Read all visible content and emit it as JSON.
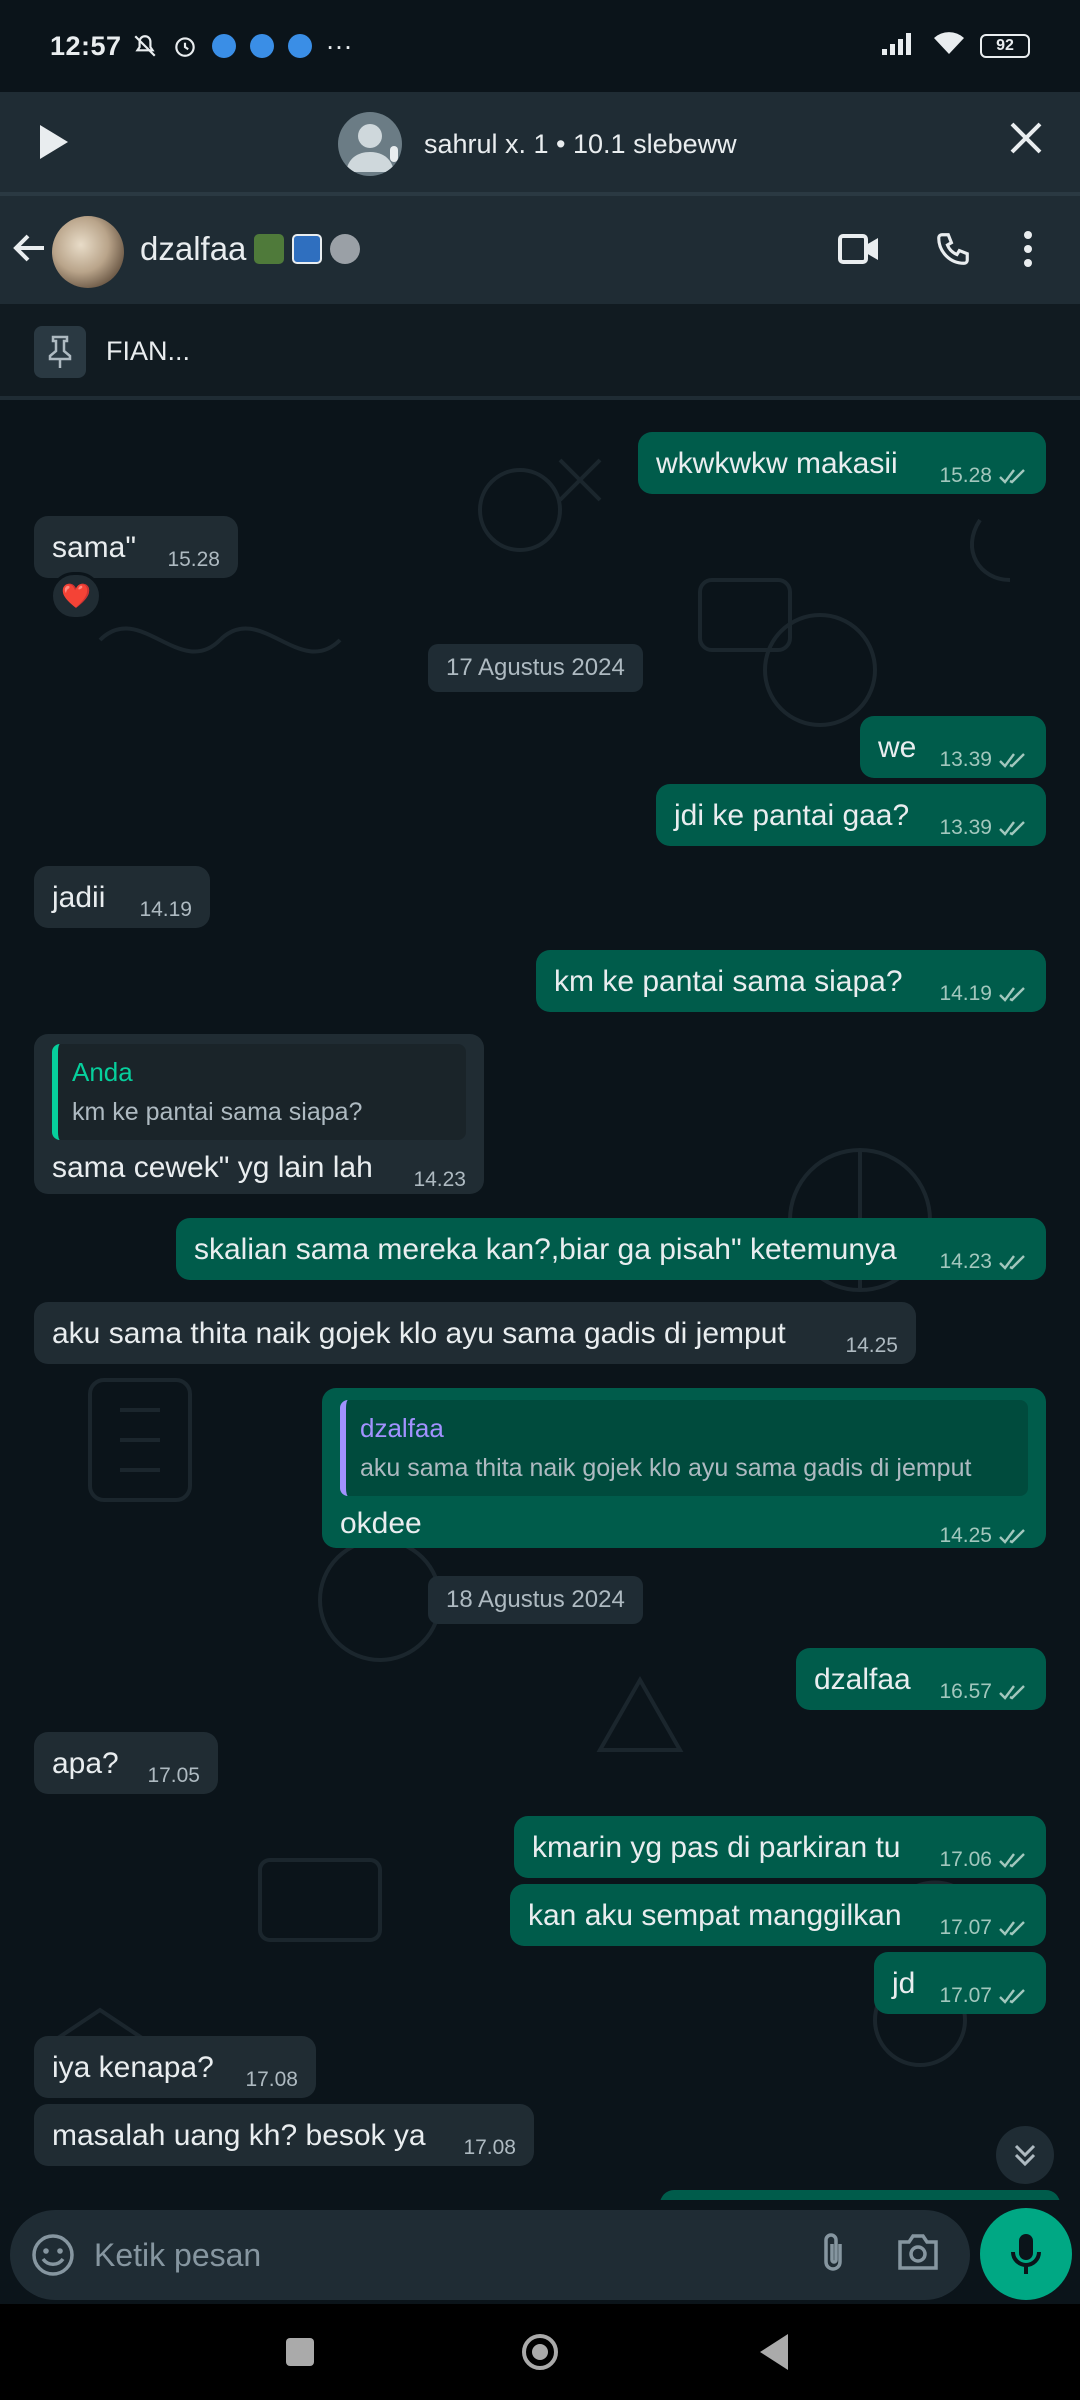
{
  "status_bar": {
    "time": "12:57",
    "battery": "92",
    "more": "···"
  },
  "call_banner": {
    "label": "sahrul x. 1 • 10.1 slebeww"
  },
  "header": {
    "name": "dzalfaa"
  },
  "pinned": {
    "text": "FIAN..."
  },
  "icons": {
    "back": "back-arrow-icon",
    "video": "video-call-icon",
    "phone": "voice-call-icon",
    "more": "more-vertical-icon",
    "pin": "pin-icon",
    "emoji": "emoji-icon",
    "attach": "attach-icon",
    "camera": "camera-icon",
    "mic": "mic-icon",
    "play": "play-icon",
    "close": "close-icon",
    "scroll": "chevrons-down-icon"
  },
  "colors": {
    "outgoing": "#005c4b",
    "incoming": "#202c33",
    "accent": "#00a884",
    "background": "#0b141a"
  },
  "messages": [
    {
      "text": "wkwkwkw makasii",
      "time": "15.28"
    },
    {
      "text": "sama\"",
      "time": "15.28",
      "reaction": "❤️"
    },
    {
      "date": "17 Agustus 2024"
    },
    {
      "text": "we",
      "time": "13.39"
    },
    {
      "text": "jdi ke pantai gaa?",
      "time": "13.39"
    },
    {
      "text": "jadii",
      "time": "14.19"
    },
    {
      "text": "km ke pantai sama siapa?",
      "time": "14.19"
    },
    {
      "quote_name": "Anda",
      "quote_text": "km ke pantai sama siapa?",
      "text": "sama cewek\" yg lain lah",
      "time": "14.23"
    },
    {
      "text": "skalian sama mereka kan?,biar ga pisah\" ketemunya",
      "time": "14.23"
    },
    {
      "text": "aku sama thita naik gojek klo ayu sama gadis di jemput",
      "time": "14.25"
    },
    {
      "quote_name": "dzalfaa",
      "quote_text": "aku sama thita naik gojek klo ayu sama gadis di jemput",
      "text": "okdee",
      "time": "14.25"
    },
    {
      "date": "18 Agustus 2024"
    },
    {
      "text": "dzalfaa",
      "time": "16.57"
    },
    {
      "text": "apa?",
      "time": "17.05"
    },
    {
      "text": "kmarin yg pas di parkiran tu",
      "time": "17.06"
    },
    {
      "text": "kan aku sempat manggilkan",
      "time": "17.07"
    },
    {
      "text": "jd",
      "time": "17.07"
    },
    {
      "text": "iya kenapa?",
      "time": "17.08"
    },
    {
      "text": "masalah uang kh? besok ya",
      "time": "17.08"
    }
  ],
  "input": {
    "placeholder": "Ketik pesan"
  }
}
